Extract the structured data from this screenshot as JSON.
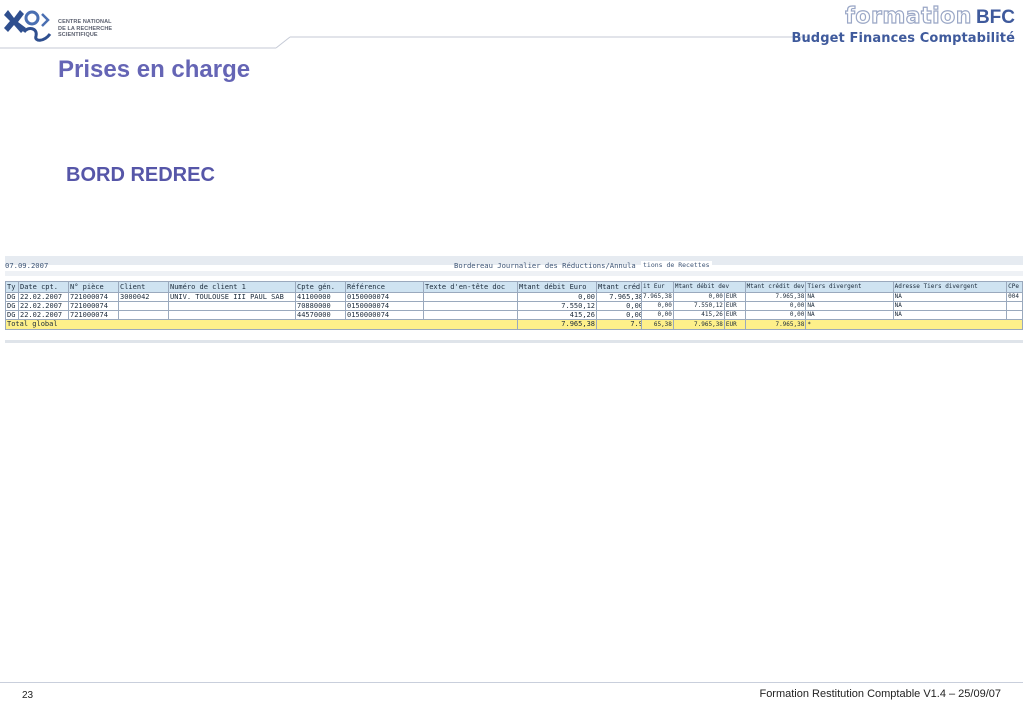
{
  "header": {
    "org_lines": [
      "CENTRE NATIONAL",
      "DE LA RECHERCHE",
      "SCIENTIFIQUE"
    ],
    "brand_formation": "formation",
    "brand_bfc": "BFC",
    "brand_subtitle": "Budget Finances Comptabilité"
  },
  "slide": {
    "title": "Prises en charge",
    "section": "BORD REDREC"
  },
  "sap": {
    "date": "07.09.2007",
    "title": "Bordereau Journalier des Réductions/Annula",
    "title_continued": "tions de Recettes",
    "columns": [
      "Ty",
      "Date cpt.",
      "N° pièce",
      "Client",
      "Numéro de client 1",
      "Cpte gén.",
      "Référence",
      "Texte d'en-tête doc",
      "Mtant débit Euro",
      "Mtant créd"
    ],
    "rows": [
      {
        "ty": "DG",
        "date": "22.02.2007",
        "piece": "721000074",
        "client": "3000042",
        "nom": "UNIV. TOULOUSE III PAUL SAB",
        "cpte": "41100000",
        "ref": "0150000074",
        "texte": "",
        "debit": "0,00",
        "credit": "7.965,38"
      },
      {
        "ty": "DG",
        "date": "22.02.2007",
        "piece": "721000074",
        "client": "",
        "nom": "",
        "cpte": "70880000",
        "ref": "0150000074",
        "texte": "",
        "debit": "7.550,12",
        "credit": "0,00"
      },
      {
        "ty": "DG",
        "date": "22.02.2007",
        "piece": "721000074",
        "client": "",
        "nom": "",
        "cpte": "44570000",
        "ref": "0150000074",
        "texte": "",
        "debit": "415,26",
        "credit": "0,00"
      }
    ],
    "total_label": "Total global",
    "total_debit": "7.965,38",
    "total_credit": "7.9",
    "columns2": [
      "it Eur",
      "Mtant débit dev",
      "",
      "Mtant crédit dev",
      "Tiers divergent",
      "Adresse Tiers divergent",
      "CPe"
    ],
    "rows2": [
      {
        "c0": "7.965,38",
        "c1": "0,00",
        "cur": "EUR",
        "c3": "7.965,38",
        "tiers": "NA",
        "adr": "NA",
        "cpe": "004"
      },
      {
        "c0": "0,00",
        "c1": "7.550,12",
        "cur": "EUR",
        "c3": "0,00",
        "tiers": "NA",
        "adr": "NA",
        "cpe": ""
      },
      {
        "c0": "0,00",
        "c1": "415,26",
        "cur": "EUR",
        "c3": "0,00",
        "tiers": "NA",
        "adr": "NA",
        "cpe": ""
      }
    ],
    "total2": {
      "c0": "65,38",
      "c1": "7.965,38",
      "cur": "EUR",
      "c3": "7.965,38",
      "tiers": "*"
    }
  },
  "footer": {
    "page_number": "23",
    "text": "Formation Restitution Comptable V1.4 – 25/09/07"
  }
}
